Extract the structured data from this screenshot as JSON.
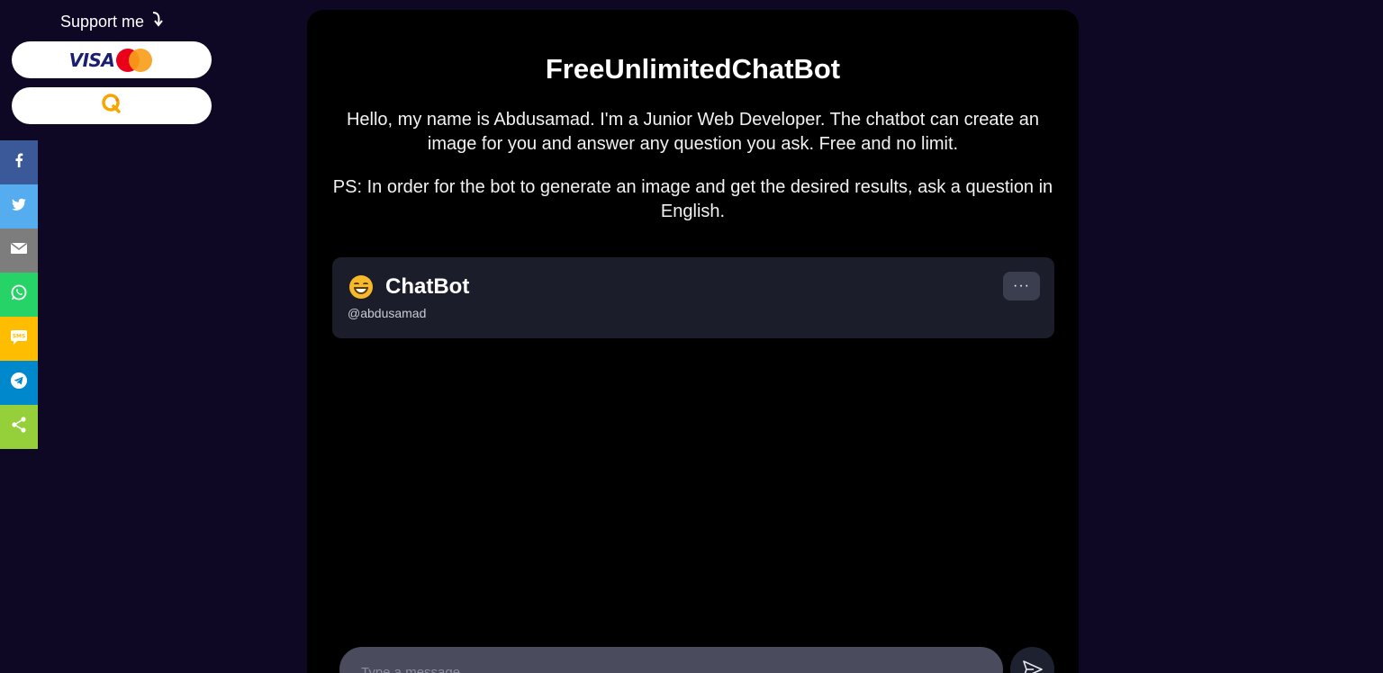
{
  "support": {
    "title": "Support me",
    "arrow_icon": "curved-arrow-down-icon",
    "buttons": [
      {
        "label": "VISA",
        "icon": "mastercard-icon"
      },
      {
        "label": "",
        "icon": "qiwi-icon"
      }
    ]
  },
  "share": {
    "items": [
      {
        "name": "facebook",
        "icon": "facebook-icon",
        "color": "#3b5998"
      },
      {
        "name": "twitter",
        "icon": "twitter-icon",
        "color": "#55acee"
      },
      {
        "name": "email",
        "icon": "email-icon",
        "color": "#7d7d7d"
      },
      {
        "name": "whatsapp",
        "icon": "whatsapp-icon",
        "color": "#25d366"
      },
      {
        "name": "sms",
        "icon": "sms-icon",
        "color": "#ffbd00"
      },
      {
        "name": "telegram",
        "icon": "telegram-icon",
        "color": "#0088cc"
      },
      {
        "name": "share",
        "icon": "share-icon",
        "color": "#95d03a"
      }
    ]
  },
  "main": {
    "title": "FreeUnlimitedChatBot",
    "intro": "Hello, my name is Abdusamad. I'm a Junior Web Developer. The chatbot can create an image for you and answer any question you ask. Free and no limit.",
    "ps": "PS: In order for the bot to generate an image and get the desired results, ask a question in English."
  },
  "chat": {
    "bot_name": "ChatBot",
    "bot_handle": "@abdusamad",
    "bot_icon": "grinning-face-icon",
    "menu_icon": "more-horizontal-icon",
    "menu_label": "···",
    "input_placeholder": "Type a message",
    "send_icon": "send-icon"
  },
  "colors": {
    "page_bg": "#0e0824",
    "card_bg": "#000000",
    "chat_header_bg": "#1b1e2a",
    "input_bg": "#4a4c5e"
  }
}
